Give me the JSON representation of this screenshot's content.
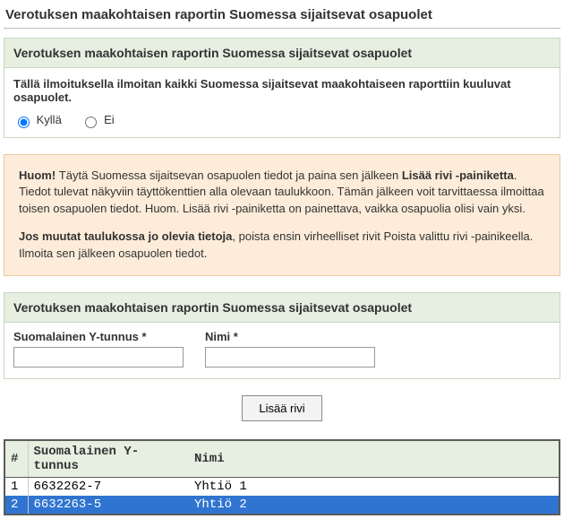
{
  "page_title": "Verotuksen maakohtaisen raportin Suomessa sijaitsevat osapuolet",
  "section1": {
    "header": "Verotuksen maakohtaisen raportin Suomessa sijaitsevat osapuolet",
    "prompt": "Tällä ilmoituksella ilmoitan kaikki Suomessa sijaitsevat maakohtaiseen raporttiin kuuluvat osapuolet.",
    "yes_label": "Kyllä",
    "no_label": "Ei"
  },
  "notice": {
    "lead": "Huom! ",
    "p1a": "Täytä Suomessa sijaitsevan osapuolen tiedot ja paina sen jälkeen ",
    "p1b_bold": "Lisää rivi -painiketta",
    "p1c": ". Tiedot tulevat näkyviin täyttökenttien alla olevaan taulukkoon. Tämän jälkeen voit tarvittaessa ilmoittaa toisen osapuolen tiedot. Huom. Lisää rivi -painiketta on painettava, vaikka osapuolia olisi vain yksi.",
    "p2a_bold": "Jos muutat taulukossa jo olevia tietoja",
    "p2b": ", poista ensin virheelliset rivit Poista valittu rivi -painikeella. Ilmoita sen jälkeen osapuolen tiedot."
  },
  "section2": {
    "header": "Verotuksen maakohtaisen raportin Suomessa sijaitsevat osapuolet",
    "ytunnus_label": "Suomalainen Y-tunnus *",
    "nimi_label": "Nimi *",
    "add_button": "Lisää rivi"
  },
  "grid": {
    "col_idx": "#",
    "col_yt": "Suomalainen Y-tunnus",
    "col_nimi": "Nimi",
    "rows": [
      {
        "idx": "1",
        "yt": "6632262-7",
        "nimi": "Yhtiö 1",
        "selected": false
      },
      {
        "idx": "2",
        "yt": "6632263-5",
        "nimi": "Yhtiö 2",
        "selected": true
      }
    ]
  }
}
